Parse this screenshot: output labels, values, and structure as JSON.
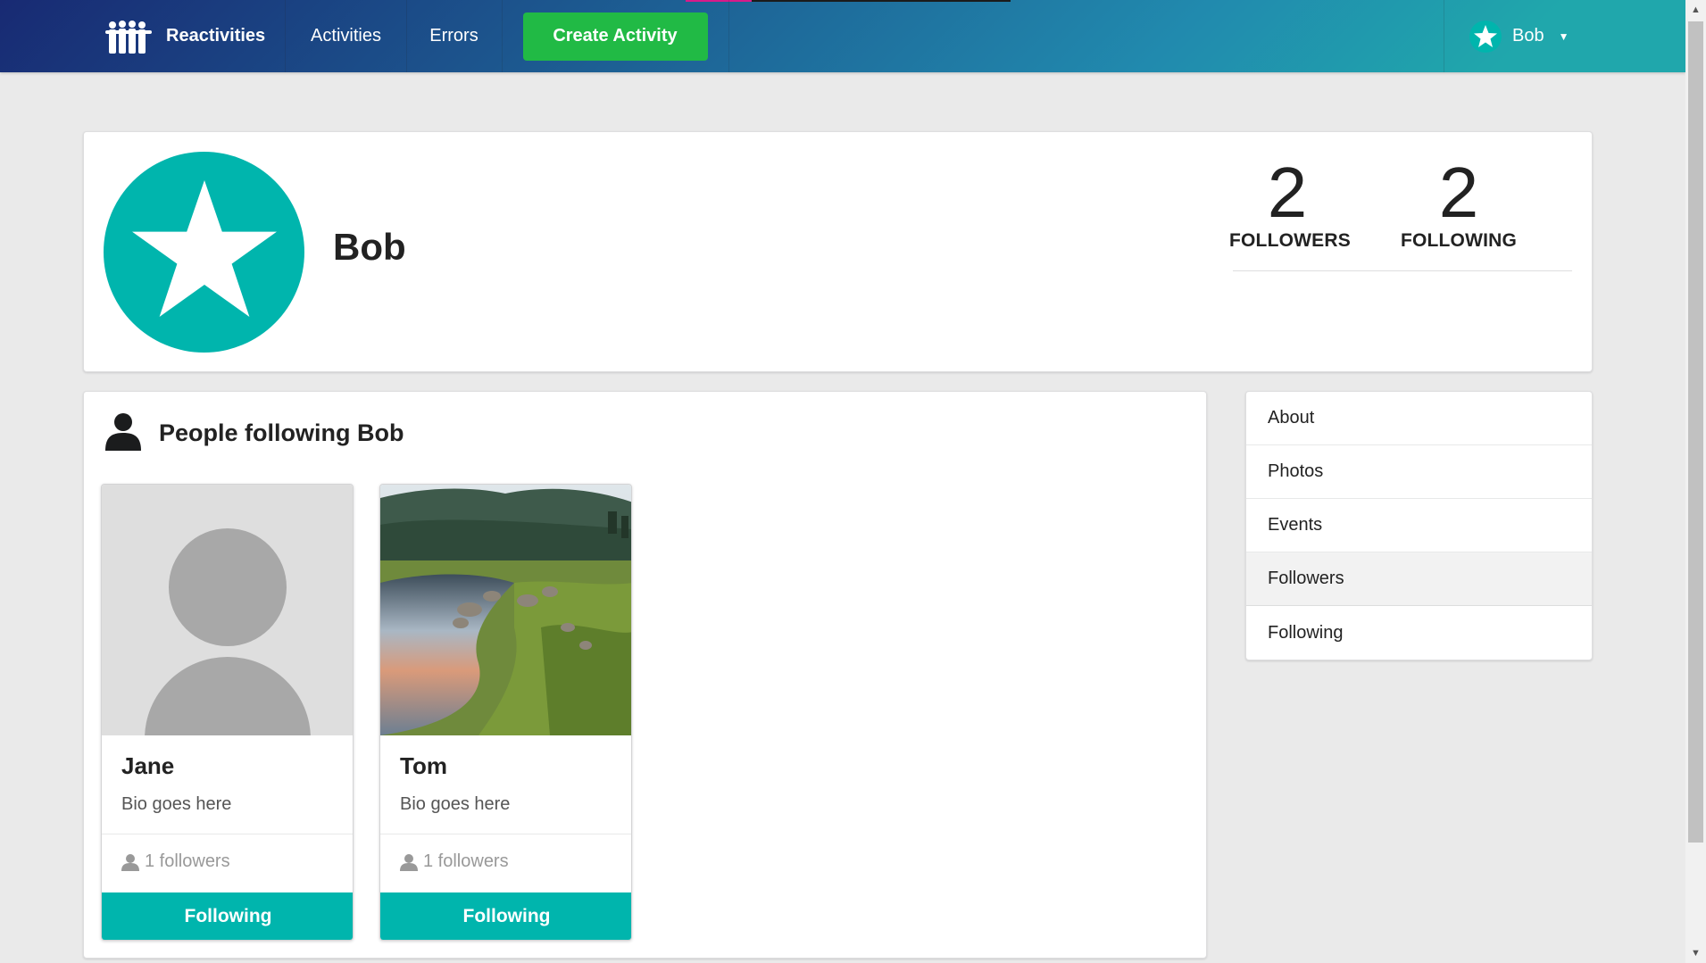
{
  "navbar": {
    "brand": "Reactivities",
    "activities": "Activities",
    "errors": "Errors",
    "create_activity": "Create Activity",
    "user_name": "Bob"
  },
  "profile": {
    "name": "Bob",
    "followers_count": "2",
    "followers_label": "FOLLOWERS",
    "following_count": "2",
    "following_label": "FOLLOWING"
  },
  "content": {
    "title": "People following Bob",
    "cards": [
      {
        "name": "Jane",
        "bio": "Bio goes here",
        "followers": "1 followers",
        "button": "Following",
        "image": "placeholder-user"
      },
      {
        "name": "Tom",
        "bio": "Bio goes here",
        "followers": "1 followers",
        "button": "Following",
        "image": "landscape-photo"
      }
    ]
  },
  "menu": {
    "items": [
      "About",
      "Photos",
      "Events",
      "Followers",
      "Following"
    ],
    "active": "Followers"
  },
  "colors": {
    "teal": "#00b5ad",
    "green": "#21ba45",
    "nav_start": "#182a73",
    "nav_end": "#20a7ac"
  },
  "icons": [
    "people-logo-icon",
    "star-icon",
    "caret-down-icon",
    "user-icon"
  ]
}
